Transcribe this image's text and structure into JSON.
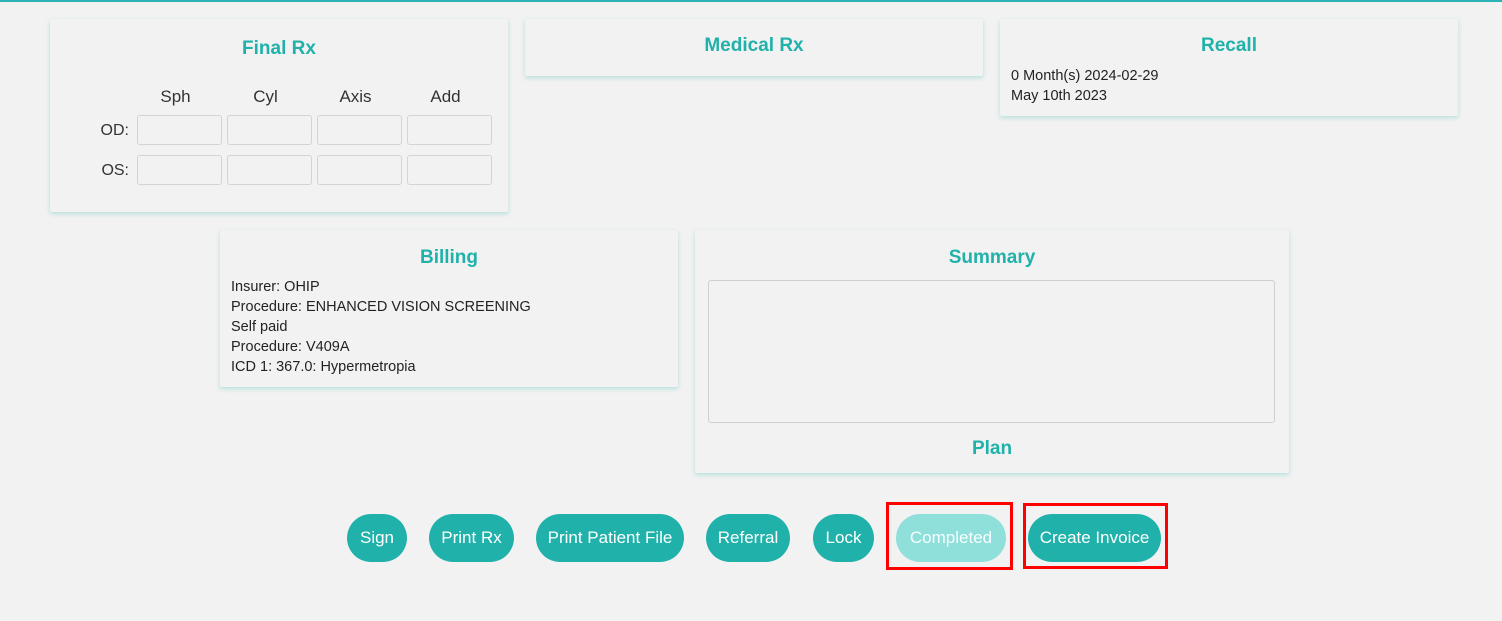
{
  "final_rx": {
    "title": "Final Rx",
    "columns": [
      "Sph",
      "Cyl",
      "Axis",
      "Add"
    ],
    "rows": [
      {
        "label": "OD:",
        "values": [
          "",
          "",
          "",
          ""
        ]
      },
      {
        "label": "OS:",
        "values": [
          "",
          "",
          "",
          ""
        ]
      }
    ]
  },
  "medical_rx": {
    "title": "Medical Rx"
  },
  "recall": {
    "title": "Recall",
    "lines": [
      "0 Month(s) 2024-02-29",
      "May 10th 2023"
    ]
  },
  "billing": {
    "title": "Billing",
    "lines": [
      "Insurer: OHIP",
      "Procedure: ENHANCED VISION SCREENING",
      "Self paid",
      "Procedure: V409A",
      "ICD 1: 367.0: Hypermetropia"
    ]
  },
  "summary": {
    "title": "Summary",
    "value": "",
    "plan_label": "Plan"
  },
  "actions": {
    "sign": "Sign",
    "print_rx": "Print Rx",
    "print_patient_file": "Print Patient File",
    "referral": "Referral",
    "lock": "Lock",
    "completed": "Completed",
    "create_invoice": "Create Invoice"
  },
  "colors": {
    "accent": "#20b2aa",
    "accent_disabled": "#8fdfda",
    "highlight": "#ff0000",
    "background": "#f2f2f2"
  }
}
